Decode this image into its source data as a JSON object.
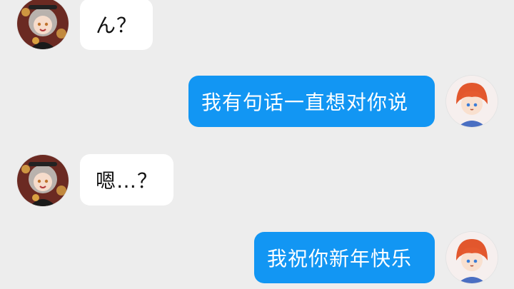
{
  "chat": {
    "messages": [
      {
        "from": "contact",
        "avatar": "girl-avatar",
        "text": "ん？"
      },
      {
        "from": "self",
        "avatar": "boy-avatar",
        "text": "我有句话一直想对你说"
      },
      {
        "from": "contact",
        "avatar": "girl-avatar",
        "text": "嗯…？"
      },
      {
        "from": "self",
        "avatar": "boy-avatar",
        "text": "我祝你新年快乐"
      }
    ]
  },
  "colors": {
    "background": "#ededed",
    "incoming_bubble": "#ffffff",
    "outgoing_bubble": "#1296f3"
  }
}
